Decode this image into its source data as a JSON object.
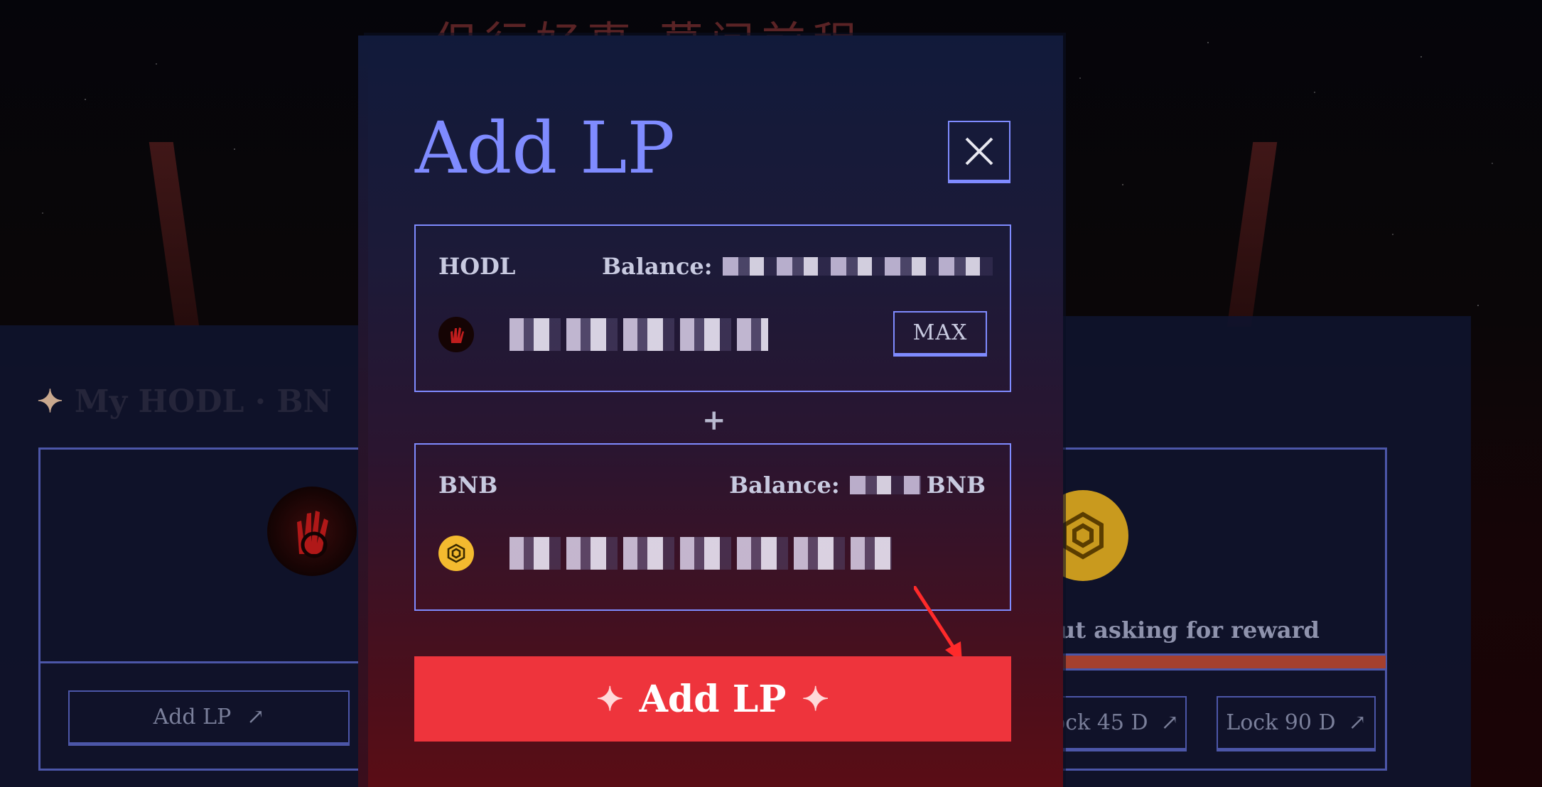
{
  "background": {
    "title": "但行好事 莫问前程",
    "heading": "My HODL · BN",
    "left_card_button": "Add LP",
    "right_card_text": "ut asking for reward",
    "lock45_label": "ock 45 D",
    "lock90_label": "Lock 90 D"
  },
  "modal": {
    "title": "Add LP",
    "close_icon": "close-icon",
    "plus": "+",
    "hodl": {
      "token": "HODL",
      "balance_label": "Balance:",
      "max_label": "MAX"
    },
    "bnb": {
      "token": "BNB",
      "balance_label": "Balance:",
      "balance_unit": "BNB"
    },
    "submit_label": "Add LP"
  },
  "colors": {
    "accent": "#7f8bff",
    "submit_bg": "#ee343c",
    "bnb_gold": "#f3ba2f"
  }
}
